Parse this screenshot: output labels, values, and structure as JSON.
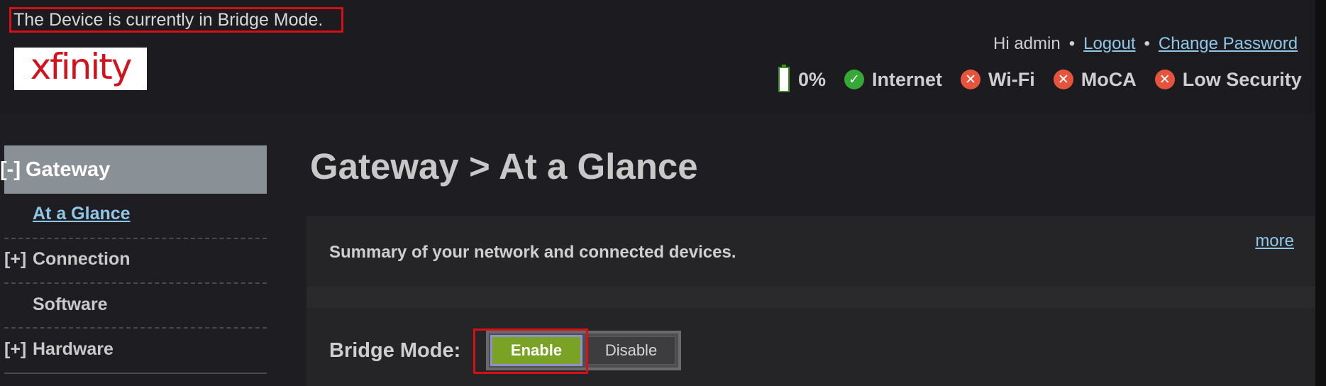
{
  "notice": {
    "text": "The Device is currently in Bridge Mode."
  },
  "logo": {
    "text": "xfinity"
  },
  "header": {
    "greeting": "Hi admin",
    "separator": "•",
    "logout": "Logout",
    "change_password": "Change Password"
  },
  "status": {
    "battery": "0%",
    "internet": "Internet",
    "wifi": "Wi-Fi",
    "moca": "MoCA",
    "security": "Low Security",
    "ok_icon": "checkmark-icon",
    "bad_icon": "x-icon"
  },
  "sidebar": {
    "gateway": {
      "toggle": "[-]",
      "label": "Gateway"
    },
    "at_a_glance": "At a Glance",
    "connection": {
      "toggle": "[+]",
      "label": "Connection"
    },
    "software": "Software",
    "hardware": {
      "toggle": "[+]",
      "label": "Hardware"
    }
  },
  "main": {
    "title": "Gateway > At a Glance",
    "summary": "Summary of your network and connected devices.",
    "more": "more",
    "bridge_mode_label": "Bridge Mode:",
    "enable": "Enable",
    "disable": "Disable"
  },
  "colors": {
    "accent_green": "#7aa326",
    "link": "#8ec7e8",
    "highlight_red": "#d90f16",
    "logo_red": "#d4121e"
  }
}
